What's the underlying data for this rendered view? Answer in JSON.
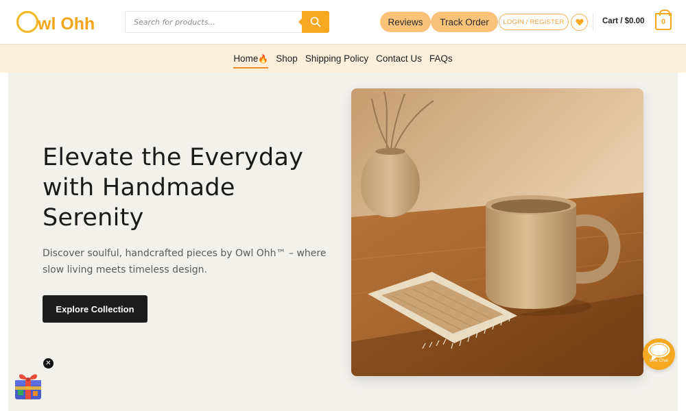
{
  "brand": {
    "logo_text": "Owl Ohh"
  },
  "search": {
    "placeholder": "Search for products..."
  },
  "header": {
    "reviews_label": "Reviews",
    "track_label": "Track Order",
    "login_label": "LOGIN / REGISTER",
    "cart_label": "Cart / $0.00",
    "cart_count": "0"
  },
  "nav": {
    "items": [
      {
        "label": "Home",
        "suffix": "🔥",
        "active": true
      },
      {
        "label": "Shop"
      },
      {
        "label": "Shipping Policy"
      },
      {
        "label": "Contact Us"
      },
      {
        "label": "FAQs"
      }
    ]
  },
  "hero": {
    "title_line1": "Elevate the Everyday",
    "title_line2": "with Handmade",
    "title_line3": "Serenity",
    "subtitle": "Discover soulful, handcrafted pieces by Owl Ohh™ – where slow living meets timeless design.",
    "cta_label": "Explore Collection"
  },
  "widgets": {
    "gift_close": "✕",
    "livechat_label": "Live Chat"
  },
  "colors": {
    "accent": "#f6a823",
    "pill": "#fbc27a",
    "nav_bg": "#fcf0dc",
    "hero_bg": "#f3f1ec",
    "cta_bg": "#1d1d1d"
  }
}
